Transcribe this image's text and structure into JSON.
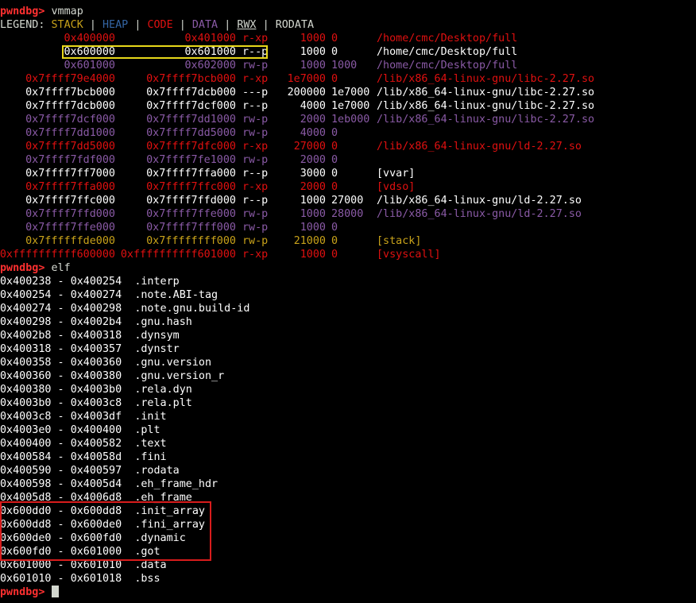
{
  "prompt": "pwndbg>",
  "cmd_vmmap": "vmmap",
  "cmd_elf": "elf",
  "legend": {
    "label": "LEGEND:",
    "stack": "STACK",
    "heap": "HEAP",
    "code": "CODE",
    "data": "DATA",
    "rwx": "RWX",
    "rodata": "RODATA",
    "sep": "|",
    "colors": {
      "stack": "#c8a21a",
      "heap": "#3465a4",
      "code": "#e01010",
      "data": "#8a5aa6",
      "rwx": "#d3d7cf",
      "rodata": "#d3d7cf"
    }
  },
  "vmmap_rows": [
    {
      "start": "0x400000",
      "end": "0x401000",
      "perms": "r-xp",
      "size": "1000",
      "offset": "0",
      "file": "/home/cmc/Desktop/full",
      "color": "red"
    },
    {
      "start": "0x600000",
      "end": "0x601000",
      "perms": "r--p",
      "size": "1000",
      "offset": "0",
      "file": "/home/cmc/Desktop/full",
      "color": "white"
    },
    {
      "start": "0x601000",
      "end": "0x602000",
      "perms": "rw-p",
      "size": "1000",
      "offset": "1000",
      "file": "/home/cmc/Desktop/full",
      "color": "purple"
    },
    {
      "start": "0x7ffff79e4000",
      "end": "0x7ffff7bcb000",
      "perms": "r-xp",
      "size": "1e7000",
      "offset": "0",
      "file": "/lib/x86_64-linux-gnu/libc-2.27.so",
      "color": "red"
    },
    {
      "start": "0x7ffff7bcb000",
      "end": "0x7ffff7dcb000",
      "perms": "---p",
      "size": "200000",
      "offset": "1e7000",
      "file": "/lib/x86_64-linux-gnu/libc-2.27.so",
      "color": "white"
    },
    {
      "start": "0x7ffff7dcb000",
      "end": "0x7ffff7dcf000",
      "perms": "r--p",
      "size": "4000",
      "offset": "1e7000",
      "file": "/lib/x86_64-linux-gnu/libc-2.27.so",
      "color": "white"
    },
    {
      "start": "0x7ffff7dcf000",
      "end": "0x7ffff7dd1000",
      "perms": "rw-p",
      "size": "2000",
      "offset": "1eb000",
      "file": "/lib/x86_64-linux-gnu/libc-2.27.so",
      "color": "purple"
    },
    {
      "start": "0x7ffff7dd1000",
      "end": "0x7ffff7dd5000",
      "perms": "rw-p",
      "size": "4000",
      "offset": "0",
      "file": "",
      "color": "purple"
    },
    {
      "start": "0x7ffff7dd5000",
      "end": "0x7ffff7dfc000",
      "perms": "r-xp",
      "size": "27000",
      "offset": "0",
      "file": "/lib/x86_64-linux-gnu/ld-2.27.so",
      "color": "red"
    },
    {
      "start": "0x7ffff7fdf000",
      "end": "0x7ffff7fe1000",
      "perms": "rw-p",
      "size": "2000",
      "offset": "0",
      "file": "",
      "color": "purple"
    },
    {
      "start": "0x7ffff7ff7000",
      "end": "0x7ffff7ffa000",
      "perms": "r--p",
      "size": "3000",
      "offset": "0",
      "file": "[vvar]",
      "color": "white"
    },
    {
      "start": "0x7ffff7ffa000",
      "end": "0x7ffff7ffc000",
      "perms": "r-xp",
      "size": "2000",
      "offset": "0",
      "file": "[vdso]",
      "color": "red"
    },
    {
      "start": "0x7ffff7ffc000",
      "end": "0x7ffff7ffd000",
      "perms": "r--p",
      "size": "1000",
      "offset": "27000",
      "file": "/lib/x86_64-linux-gnu/ld-2.27.so",
      "color": "white"
    },
    {
      "start": "0x7ffff7ffd000",
      "end": "0x7ffff7ffe000",
      "perms": "rw-p",
      "size": "1000",
      "offset": "28000",
      "file": "/lib/x86_64-linux-gnu/ld-2.27.so",
      "color": "purple"
    },
    {
      "start": "0x7ffff7ffe000",
      "end": "0x7ffff7fff000",
      "perms": "rw-p",
      "size": "1000",
      "offset": "0",
      "file": "",
      "color": "purple"
    },
    {
      "start": "0x7ffffffde000",
      "end": "0x7ffffffff000",
      "perms": "rw-p",
      "size": "21000",
      "offset": "0",
      "file": "[stack]",
      "color": "yellow"
    },
    {
      "start": "0xffffffffff600000",
      "end": "0xffffffffff601000",
      "perms": "r-xp",
      "size": "1000",
      "offset": "0",
      "file": "[vsyscall]",
      "color": "red"
    }
  ],
  "elf_rows": [
    {
      "start": "0x400238",
      "end": "0x400254",
      "name": ".interp"
    },
    {
      "start": "0x400254",
      "end": "0x400274",
      "name": ".note.ABI-tag"
    },
    {
      "start": "0x400274",
      "end": "0x400298",
      "name": ".note.gnu.build-id"
    },
    {
      "start": "0x400298",
      "end": "0x4002b4",
      "name": ".gnu.hash"
    },
    {
      "start": "0x4002b8",
      "end": "0x400318",
      "name": ".dynsym"
    },
    {
      "start": "0x400318",
      "end": "0x400357",
      "name": ".dynstr"
    },
    {
      "start": "0x400358",
      "end": "0x400360",
      "name": ".gnu.version"
    },
    {
      "start": "0x400360",
      "end": "0x400380",
      "name": ".gnu.version_r"
    },
    {
      "start": "0x400380",
      "end": "0x4003b0",
      "name": ".rela.dyn"
    },
    {
      "start": "0x4003b0",
      "end": "0x4003c8",
      "name": ".rela.plt"
    },
    {
      "start": "0x4003c8",
      "end": "0x4003df",
      "name": ".init"
    },
    {
      "start": "0x4003e0",
      "end": "0x400400",
      "name": ".plt"
    },
    {
      "start": "0x400400",
      "end": "0x400582",
      "name": ".text"
    },
    {
      "start": "0x400584",
      "end": "0x40058d",
      "name": ".fini"
    },
    {
      "start": "0x400590",
      "end": "0x400597",
      "name": ".rodata"
    },
    {
      "start": "0x400598",
      "end": "0x4005d4",
      "name": ".eh_frame_hdr"
    },
    {
      "start": "0x4005d8",
      "end": "0x4006d8",
      "name": ".eh_frame"
    },
    {
      "start": "0x600dd0",
      "end": "0x600dd8",
      "name": ".init_array"
    },
    {
      "start": "0x600dd8",
      "end": "0x600de0",
      "name": ".fini_array"
    },
    {
      "start": "0x600de0",
      "end": "0x600fd0",
      "name": ".dynamic"
    },
    {
      "start": "0x600fd0",
      "end": "0x601000",
      "name": ".got"
    },
    {
      "start": "0x601000",
      "end": "0x601010",
      "name": ".data"
    },
    {
      "start": "0x601010",
      "end": "0x601018",
      "name": ".bss"
    }
  ]
}
